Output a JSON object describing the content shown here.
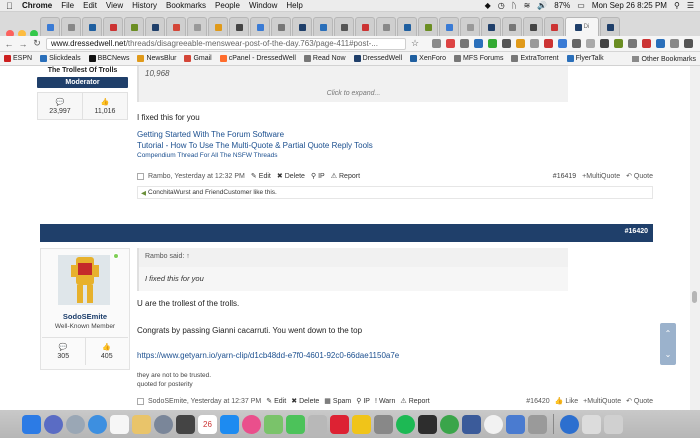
{
  "menubar": {
    "app": "Chrome",
    "items": [
      "File",
      "Edit",
      "View",
      "History",
      "Bookmarks",
      "People",
      "Window",
      "Help"
    ],
    "battery": "87%",
    "clock": "Mon Sep 26  8:25 PM"
  },
  "tabs": {
    "active_label": "Di"
  },
  "address": {
    "host": "www.dressedwell.net",
    "path": "/threads/disagreeable-menswear-post-of-the-day.763/page-411#post-..."
  },
  "bookmarks": {
    "items": [
      {
        "label": "ESPN",
        "color": "#cc1f1f"
      },
      {
        "label": "Slickdeals",
        "color": "#2a6fba"
      },
      {
        "label": "BBCNews",
        "color": "#111111"
      },
      {
        "label": "NewsBlur",
        "color": "#e09a1a"
      },
      {
        "label": "Gmail",
        "color": "#d44638"
      },
      {
        "label": "cPanel - DressedWell",
        "color": "#ff6c2c"
      },
      {
        "label": "Read Now",
        "color": "#777777"
      },
      {
        "label": "DressedWell",
        "color": "#1f3f6a"
      },
      {
        "label": "XenForo",
        "color": "#1f5fa0"
      },
      {
        "label": "MFS Forums",
        "color": "#777777"
      },
      {
        "label": "ExtraTorrent",
        "color": "#777777"
      },
      {
        "label": "FlyerTalk",
        "color": "#2a6fba"
      }
    ],
    "other": "Other Bookmarks"
  },
  "post1": {
    "username": "The Trollest Of Trolls",
    "role": "Moderator",
    "stat_messages": "23,997",
    "stat_likes": "11,016",
    "quote_value": "10,968",
    "quote_expand": "Click to expand...",
    "text": "I fixed this for you",
    "sig_links": [
      "Getting Started With The Forum Software",
      "Tutorial - How To Use The Multi-Quote & Partial Quote Reply Tools",
      "Compendium Thread For All The NSFW Threads"
    ],
    "footer_meta": "Rambo, Yesterday at 12:32 PM",
    "actions": {
      "edit": "Edit",
      "delete": "Delete",
      "ip": "IP",
      "report": "Report"
    },
    "post_number": "#16419",
    "multiquote": "+MultiQuote",
    "quote": "Quote",
    "likes_text": "ConchitaWurst and FriendCustomer like this."
  },
  "divider": {
    "post_number": "#16420"
  },
  "post2": {
    "username": "SodoSEmite",
    "role": "Well-Known Member",
    "stat_messages": "305",
    "stat_likes": "405",
    "quote_header": "Rambo said: ↑",
    "quote_text": "I fixed this for you",
    "line1": "U are the trollest of the trolls.",
    "line2": "Congrats by passing Gianni cacarruti. You went down to the top",
    "link": "https://www.getyarn.io/yarn-clip/d1cb48dd-e7f0-4601-92c0-66dae1150a7e",
    "sig_line1": "they are not to be trusted.",
    "sig_line2": "quoted for posterity",
    "footer_meta": "SodoSEmite, Yesterday at 12:37 PM",
    "actions": {
      "edit": "Edit",
      "delete": "Delete",
      "spam": "Spam",
      "ip": "IP",
      "warn": "Warn",
      "report": "Report"
    },
    "post_number": "#16420",
    "like": "Like",
    "multiquote": "+MultiQuote",
    "quote": "Quote"
  },
  "dock": {
    "date_icon": "26"
  }
}
